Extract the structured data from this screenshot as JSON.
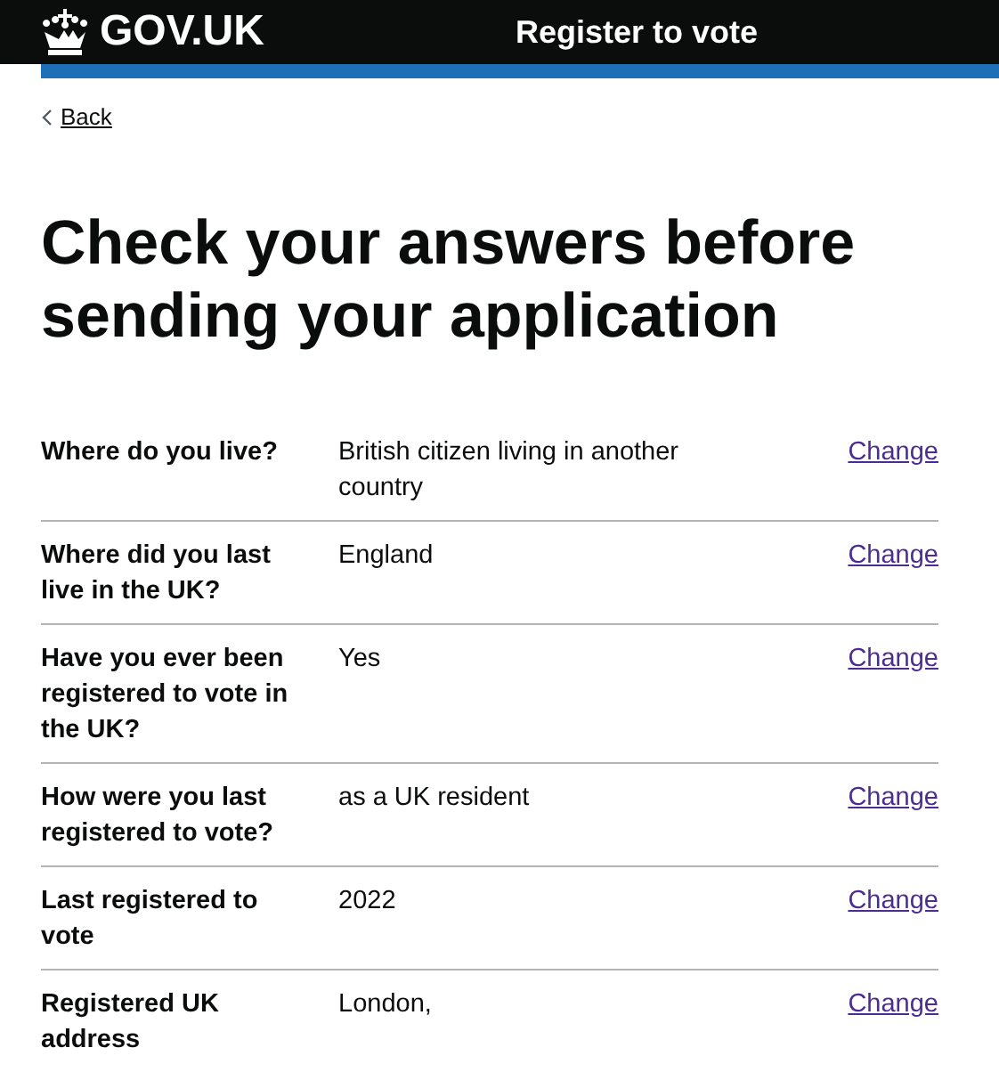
{
  "header": {
    "logo": "GOV.UK",
    "service": "Register to vote"
  },
  "back_link": "Back",
  "title": "Check your answers before sending your application",
  "summary": [
    {
      "question": "Where do you live?",
      "answer": "British citizen living in another country",
      "action": "Change"
    },
    {
      "question": "Where did you last live in the UK?",
      "answer": "England",
      "action": "Change"
    },
    {
      "question": "Have you ever been registered to vote in the UK?",
      "answer": "Yes",
      "action": "Change"
    },
    {
      "question": "How were you last registered to vote?",
      "answer": "as a UK resident",
      "action": "Change"
    },
    {
      "question": "Last registered to vote",
      "answer": "2022",
      "action": "Change"
    },
    {
      "question": "Registered UK address",
      "answer": "London,",
      "action": "Change"
    }
  ]
}
